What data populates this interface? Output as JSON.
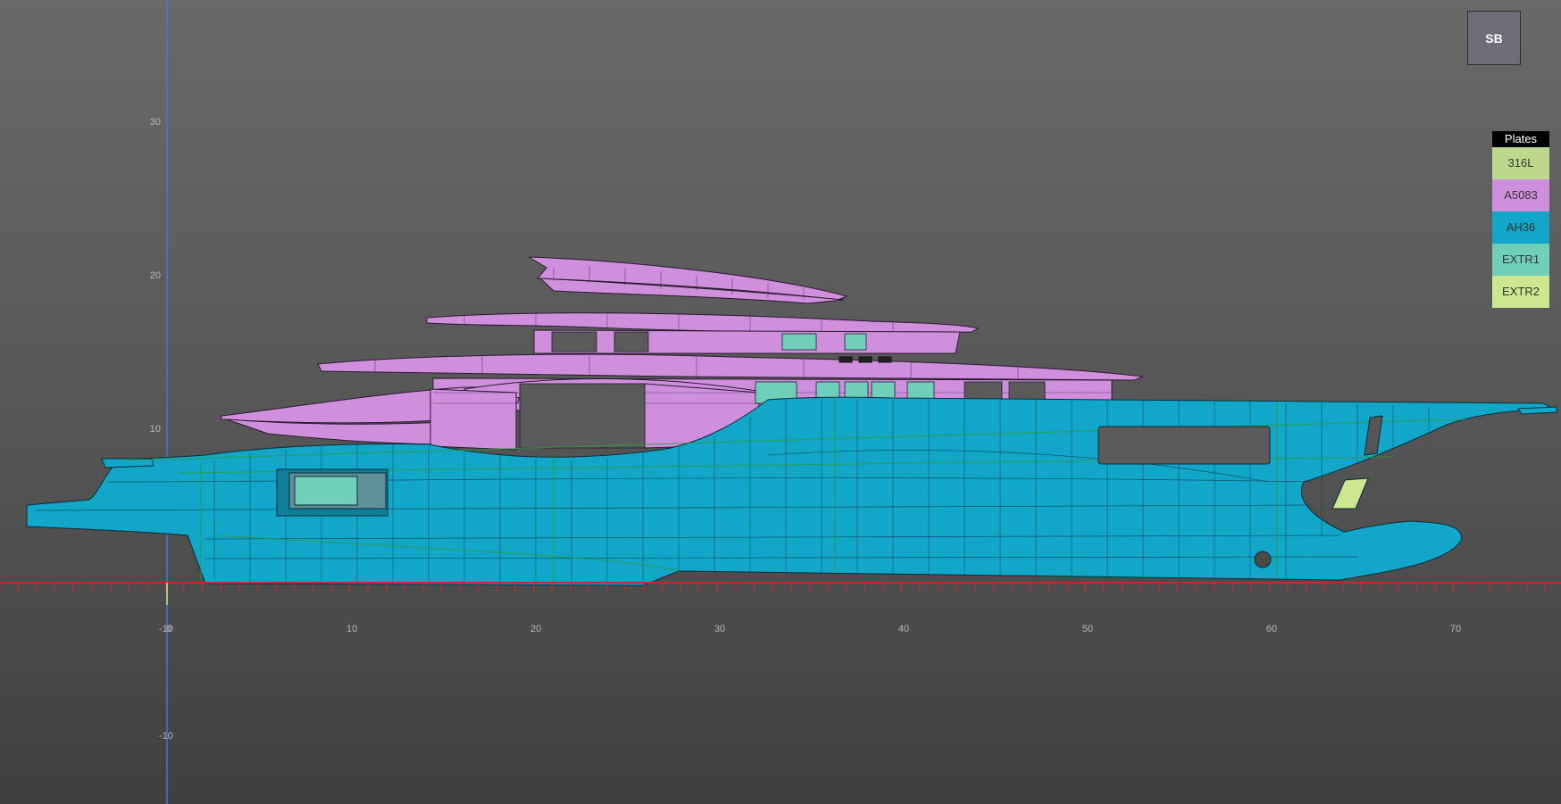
{
  "view": {
    "button_label": "SB",
    "background_top": "#696969",
    "background_bottom": "#3f3f3f"
  },
  "legend": {
    "title": "Plates",
    "items": [
      {
        "label": "316L",
        "color": "#bcd98b"
      },
      {
        "label": "A5083",
        "color": "#cf8fdc"
      },
      {
        "label": "AH36",
        "color": "#12a6c8"
      },
      {
        "label": "EXTR1",
        "color": "#6fcfb9"
      },
      {
        "label": "EXTR2",
        "color": "#cde690"
      }
    ]
  },
  "axes": {
    "x_ticks": [
      "10",
      "20",
      "30",
      "40",
      "50",
      "60",
      "70"
    ],
    "origin_labels": [
      "-10",
      "0"
    ],
    "y_ticks": [
      "30",
      "20",
      "10",
      "-10"
    ],
    "x_axis_color": "#c42a2a",
    "y_axis_color": "#3a7fd0"
  },
  "colors": {
    "hull": "#12a6c8",
    "superstructure": "#cf8fdc",
    "window": "#6fcfb9",
    "vent": "#cde690",
    "frame_lines": "#1d1d2a",
    "green_lines": "#2f9a3e"
  }
}
